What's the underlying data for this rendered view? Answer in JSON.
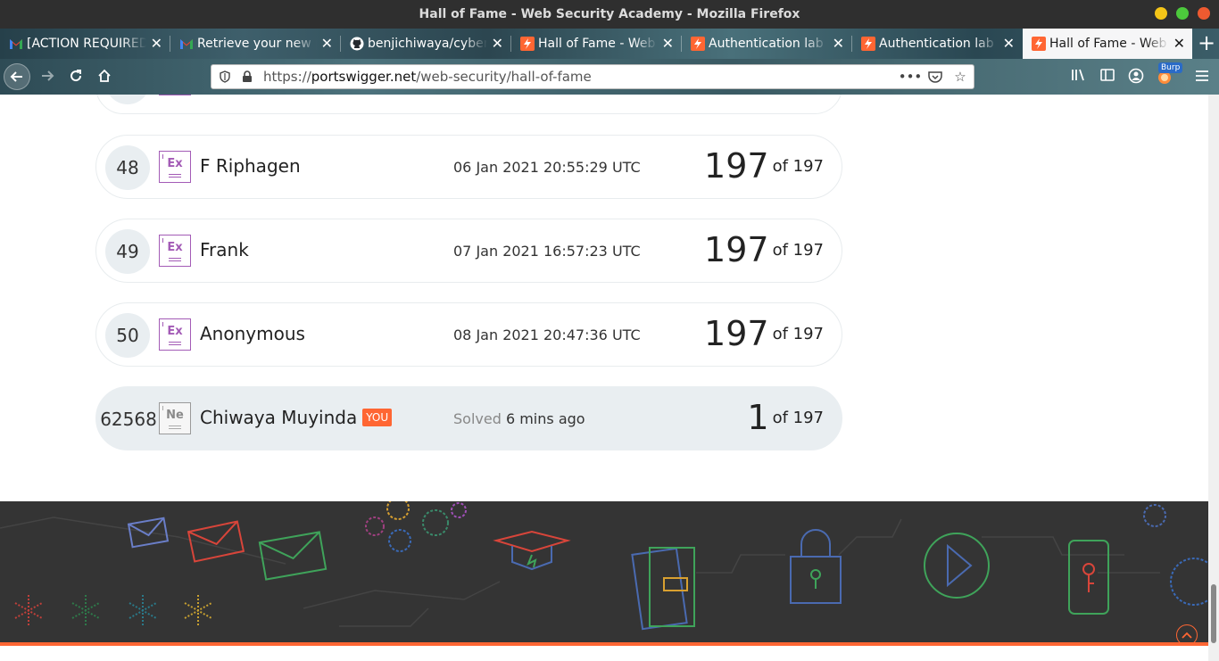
{
  "window": {
    "title": "Hall of Fame - Web Security Academy - Mozilla Firefox"
  },
  "tabs": [
    {
      "label": "[ACTION REQUIRED] P",
      "icon": "gmail-icon"
    },
    {
      "label": "Retrieve your new pa",
      "icon": "gmail-icon"
    },
    {
      "label": "benjichiwaya/cyberse",
      "icon": "github-icon"
    },
    {
      "label": "Hall of Fame - Web S",
      "icon": "portswigger-icon"
    },
    {
      "label": "Authentication lab u",
      "icon": "portswigger-icon"
    },
    {
      "label": "Authentication lab p",
      "icon": "portswigger-icon"
    },
    {
      "label": "Hall of Fame - Web S",
      "icon": "portswigger-icon",
      "active": true
    }
  ],
  "urlbar": {
    "prefix": "https://",
    "host": "portswigger.net",
    "path": "/web-security/hall-of-fame"
  },
  "toolbar": {
    "burp_badge": "Burp"
  },
  "leaderboard": [
    {
      "rank": "48",
      "level": "Ex",
      "name": "F Riphagen",
      "date": "06 Jan 2021 20:55:29 UTC",
      "solved": "197",
      "of": "of 197"
    },
    {
      "rank": "49",
      "level": "Ex",
      "name": "Frank",
      "date": "07 Jan 2021 16:57:23 UTC",
      "solved": "197",
      "of": "of 197"
    },
    {
      "rank": "50",
      "level": "Ex",
      "name": "Anonymous",
      "date": "08 Jan 2021 20:47:36 UTC",
      "solved": "197",
      "of": "of 197"
    }
  ],
  "you_row": {
    "rank": "62568",
    "level": "Ne",
    "name": "Chiwaya Muyinda",
    "you_tag": "YOU",
    "solved_label": "Solved",
    "solved_time": "6 mins ago",
    "solved": "1",
    "of": "of 197"
  },
  "colors": {
    "accent": "#ff6633",
    "expert": "#a35bb6",
    "footer_bg": "#343434"
  }
}
